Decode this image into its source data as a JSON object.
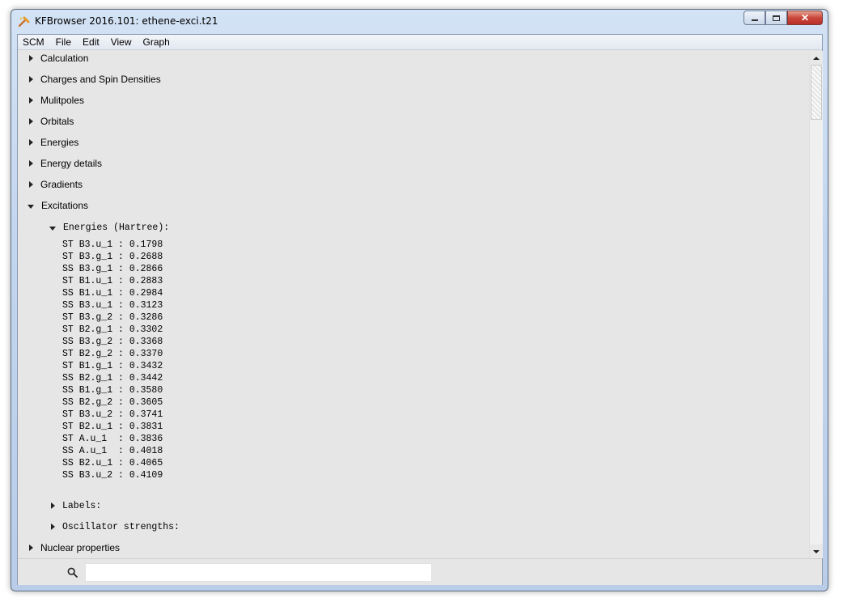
{
  "window": {
    "title": "KFBrowser 2016.101: ethene-exci.t21",
    "controls": [
      "minimize",
      "maximize",
      "close"
    ]
  },
  "menubar": {
    "items": [
      "SCM",
      "File",
      "Edit",
      "View",
      "Graph"
    ]
  },
  "tree": {
    "sections": [
      {
        "label": "Calculation",
        "expanded": false
      },
      {
        "label": "Charges and Spin Densities",
        "expanded": false
      },
      {
        "label": "Mulitpoles",
        "expanded": false
      },
      {
        "label": "Orbitals",
        "expanded": false
      },
      {
        "label": "Energies",
        "expanded": false
      },
      {
        "label": "Energy details",
        "expanded": false
      },
      {
        "label": "Gradients",
        "expanded": false
      },
      {
        "label": "Excitations",
        "expanded": true
      }
    ],
    "excitations": {
      "energies_header": "Energies (Hartree):",
      "energies": [
        "ST B3.u_1 : 0.1798",
        "ST B3.g_1 : 0.2688",
        "SS B3.g_1 : 0.2866",
        "ST B1.u_1 : 0.2883",
        "SS B1.u_1 : 0.2984",
        "SS B3.u_1 : 0.3123",
        "ST B3.g_2 : 0.3286",
        "ST B2.g_1 : 0.3302",
        "SS B3.g_2 : 0.3368",
        "ST B2.g_2 : 0.3370",
        "ST B1.g_1 : 0.3432",
        "SS B2.g_1 : 0.3442",
        "SS B1.g_1 : 0.3580",
        "SS B2.g_2 : 0.3605",
        "ST B3.u_2 : 0.3741",
        "ST B2.u_1 : 0.3831",
        "ST A.u_1  : 0.3836",
        "SS A.u_1  : 0.4018",
        "SS B2.u_1 : 0.4065",
        "SS B3.u_2 : 0.4109"
      ],
      "labels_header": "Labels:",
      "oscillator_header": "Oscillator strengths:"
    },
    "last_section": "Nuclear properties"
  },
  "search": {
    "value": "",
    "placeholder": ""
  },
  "icons": {
    "app": "scm-app-icon",
    "search": "search-icon"
  }
}
